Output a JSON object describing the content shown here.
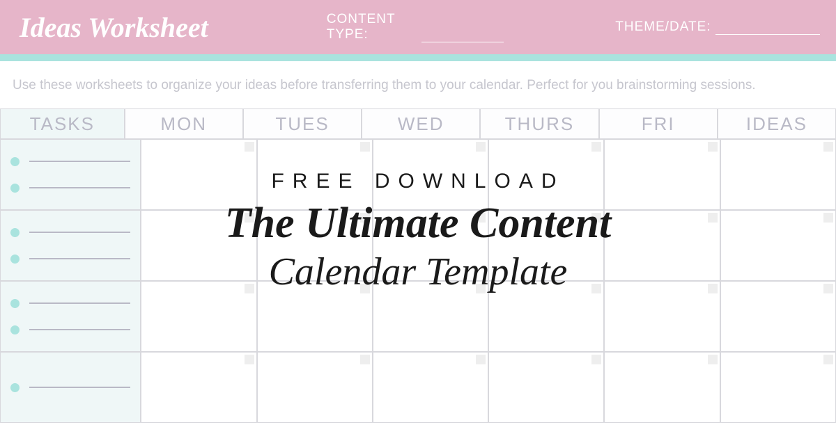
{
  "header": {
    "title": "Ideas Worksheet",
    "content_type_label": "CONTENT TYPE:",
    "theme_date_label": "THEME/DATE:"
  },
  "instructions": "Use these worksheets to organize your ideas before transferring them to your calendar. Perfect for you brainstorming sessions.",
  "columns": {
    "tasks": "TASKS",
    "mon": "MON",
    "tues": "TUES",
    "wed": "WED",
    "thurs": "THURS",
    "fri": "FRI",
    "ideas": "IDEAS"
  },
  "overlay": {
    "line1": "FREE DOWNLOAD",
    "line2": "The Ultimate Content",
    "line3": "Calendar Template"
  }
}
